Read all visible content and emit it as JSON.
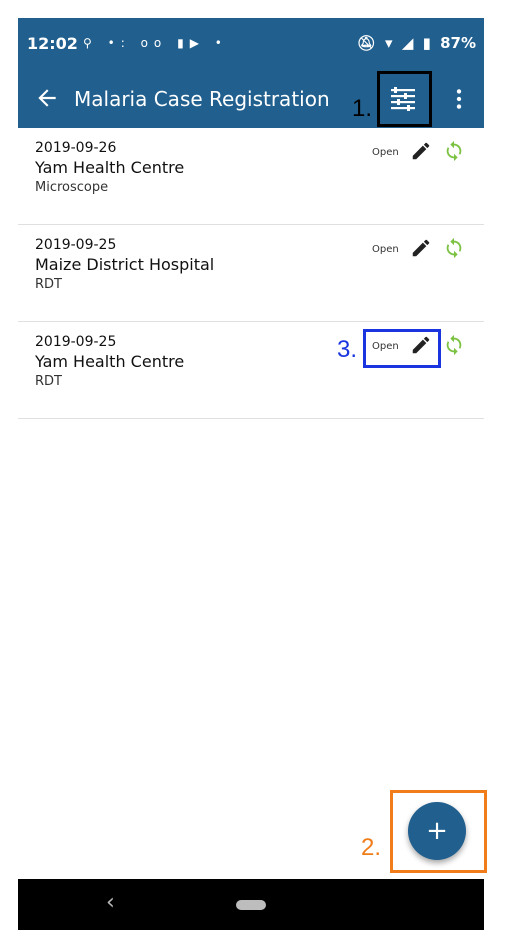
{
  "status_bar": {
    "time": "12:02",
    "left_icons": [
      "location-icon",
      "assistant-icon",
      "voicemail-icon",
      "app-icon",
      "dot-icon"
    ],
    "battery": "87%",
    "right_icons": [
      "dnd-off-icon",
      "wifi-icon",
      "signal-icon",
      "battery-icon"
    ]
  },
  "app_bar": {
    "title": "Malaria Case Registration",
    "back_icon": "arrow-left-icon",
    "filter_icon": "filter-sliders-icon",
    "overflow_icon": "more-vert-icon",
    "color": "#205f8e"
  },
  "events": [
    {
      "date": "2019-09-26",
      "org_unit": "Yam Health Centre",
      "type": "Microscope",
      "status": "Open"
    },
    {
      "date": "2019-09-25",
      "org_unit": "Maize District Hospital",
      "type": "RDT",
      "status": "Open"
    },
    {
      "date": "2019-09-25",
      "org_unit": "Yam Health Centre",
      "type": "RDT",
      "status": "Open"
    }
  ],
  "fab": {
    "label": "+"
  },
  "nav_bar": {
    "back": "‹"
  },
  "annotations": [
    {
      "label": "1.",
      "color": "#000000"
    },
    {
      "label": "2.",
      "color": "#f07c1a"
    },
    {
      "label": "3.",
      "color": "#1a35e0"
    }
  ],
  "colors": {
    "sync_green": "#7cc242",
    "edit_dark": "#222222"
  }
}
